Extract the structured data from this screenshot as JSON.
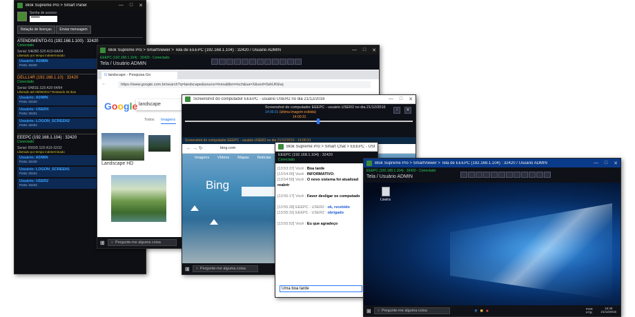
{
  "smart_panel": {
    "title": "Blok Supreme Pro > Smart Panel",
    "password_label": "Senha de acesso:",
    "password_value": "••••••",
    "btn_license": "Relação de licenças",
    "btn_send": "Enviar mensagem",
    "computers": [
      {
        "name": "ATENDIMENTO-01 (192.168.1.100) : 32420",
        "status": "Conectado",
        "serial": "Serial: 54EBD.S20 A19-6A/64",
        "note": "Liberado por tempo indeterminado",
        "users": [
          {
            "u": "Usuário: ADMIN",
            "p": "Porta: 32420"
          }
        ]
      },
      {
        "name": "DELL14R (192.168.1.10) : 32420",
        "status": "Conectado",
        "serial": "Serial: 0AB1E.S20 A20 64/64",
        "note": "Liberado até 09/06/2017  Restando 26 dias",
        "users": [
          {
            "u": "Usuário: ADMIN",
            "p": "Porta: 32420"
          },
          {
            "u": "Usuário: USERX",
            "p": "Porta: 32421"
          },
          {
            "u": "Usuário: LOGON_SCREEN2",
            "p": "Porta: 32422"
          }
        ]
      },
      {
        "name": "EEEPC (192.168.1.104) : 32420",
        "status": "Conectado",
        "serial": "Serial: 6560D.S20 A19-32/32",
        "note": "Liberado por tempo indeterminado",
        "users": [
          {
            "u": "Usuário: ADMIN",
            "p": "Porta: 32420"
          },
          {
            "u": "Usuário: LOGON_SCREEN1",
            "p": "Porta: 32421"
          },
          {
            "u": "Usuário: USER2",
            "p": "Porta: 32422"
          }
        ]
      }
    ]
  },
  "viewer1": {
    "title": "Blok Supreme Pro > SmartViewer > Tela de EEEPC (192.168.1.104) : 32420 / Usuário ADMIN",
    "conn": "EEEPC (192.168.1.104) : 32420 - Conectado",
    "sub": "Tela / Usuário ADMIN",
    "tab": "landscape - Pesquisa Go",
    "url": "https://www.google.com.br/search?q=landscape&source=lnms&tbm=isch&sa=X&ved=0ahUKEwj",
    "query": "landscape",
    "tab_all": "Todos",
    "tab_images": "Imagens",
    "img_caption": "Landscape HD",
    "search": "Pergunte-me alguma coisa"
  },
  "screenshot": {
    "title": "Screenshot do computador EEEPC - usuário USER2 no dia 21/12/2016",
    "header": "Screenshot do computador EEEPC - usuário USER2 no dia 21/12/2016",
    "time1": "14:00:31",
    "time_note": "(última imagem exibida)",
    "time2": "14:00:31",
    "inner_title": "Screenshot do computador EEEPC - usuário USER2 no dia 21/12/2016 - 14:00:31",
    "url": "bing.com",
    "logo": "Bing",
    "nav": [
      "Imagens",
      "Vídeos",
      "Mapas",
      "Notícias"
    ],
    "search": "Pergunte-me alguma coisa"
  },
  "chat": {
    "title": "Blok Supreme Pro > Smart Chat > EEEPC - USER2",
    "conn": "EEEPC (192.168.1.104) : 32420",
    "status": "Conectado",
    "messages": [
      {
        "t": "[13:53:37] Você : ",
        "m": "Boa tarde",
        "c": "#000"
      },
      {
        "t": "[13:54:00] Você : ",
        "m": "INFORMATIVO:",
        "c": "#000"
      },
      {
        "t": "[13:54:56] Você : ",
        "m": "O novo sistema foi atualizad",
        "c": "#000"
      },
      {
        "t": "",
        "m": "reabrir",
        "c": "#000"
      },
      {
        "t": "[13:55:17] Você : ",
        "m": "Favor desligar os computado",
        "c": "#000"
      },
      {
        "t": "[13:55:28] EEEPC - USER2 : ",
        "m": "ok, recebido",
        "c": "#1a57d6"
      },
      {
        "t": "[13:55:31] EEEPC - USER2 : ",
        "m": "obrigado",
        "c": "#1a57d6"
      },
      {
        "t": "[13:55:52] Você : ",
        "m": "Eu que agradeço",
        "c": "#000"
      }
    ],
    "input": "Uma boa tarde"
  },
  "viewer2": {
    "title": "Blok Supreme Pro > SmartViewer > Tela de EEEPC (192.168.1.104) : 32420 / Usuário ADMIN",
    "conn": "EEEPC (192.168.1.104) : 32420 - Conectado",
    "sub": "Tela / Usuário ADMIN",
    "desktop_icon": "Lixeira",
    "search": "Pergunte-me alguma coisa",
    "lang": "POR PTB",
    "time": "16:49",
    "date": "21/12/2016"
  }
}
